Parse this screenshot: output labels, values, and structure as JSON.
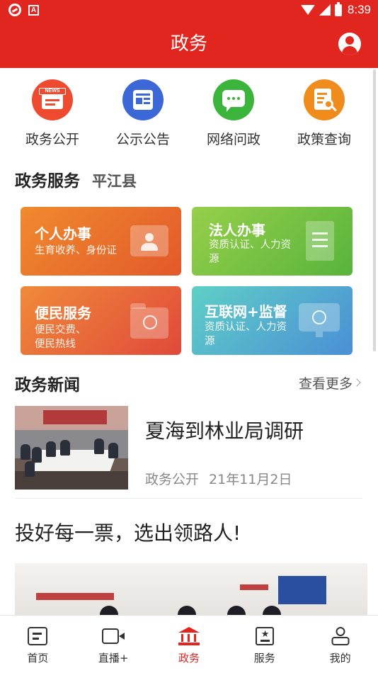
{
  "status_bar": {
    "time": "8:39",
    "icons": [
      "app-notification-icon",
      "app-a-icon",
      "wifi-icon",
      "signal-icon",
      "battery-charging-icon"
    ]
  },
  "header": {
    "title": "政务",
    "right_icon": "user-icon"
  },
  "quick_links": [
    {
      "label": "政务公开",
      "icon": "news-icon",
      "color": "#ee4a30"
    },
    {
      "label": "公示公告",
      "icon": "notice-icon",
      "color": "#3c67d6"
    },
    {
      "label": "网络问政",
      "icon": "chat-icon",
      "color": "#3ab43a"
    },
    {
      "label": "政策查询",
      "icon": "policy-search-icon",
      "color": "#f08c1c"
    }
  ],
  "services": {
    "title": "政务服务",
    "county": "平江县",
    "cards": [
      {
        "title": "个人办事",
        "subtitle": "生育收养、身份证",
        "icon": "person-id-icon"
      },
      {
        "title": "法人办事",
        "subtitle": "资质认证、人力资源",
        "icon": "document-icon"
      },
      {
        "title": "便民服务",
        "subtitle": "便民交费、便民热线",
        "icon": "folder-compass-icon"
      },
      {
        "title": "互联网+监督",
        "subtitle": "资质认证、人力资源",
        "icon": "monitor-eye-icon"
      }
    ]
  },
  "news": {
    "title": "政务新闻",
    "more_label": "查看更多",
    "items": [
      {
        "title": "夏海到林业局调研",
        "category": "政务公开",
        "date": "21年11月2日"
      }
    ]
  },
  "feature": {
    "headline": "投好每一票，选出领路人!"
  },
  "bottom_nav": [
    {
      "label": "首页",
      "icon": "home-icon",
      "active": false
    },
    {
      "label": "直播+",
      "icon": "video-camera-icon",
      "active": false
    },
    {
      "label": "政务",
      "icon": "government-building-icon",
      "active": true
    },
    {
      "label": "服务",
      "icon": "service-star-icon",
      "active": false
    },
    {
      "label": "我的",
      "icon": "profile-icon",
      "active": false
    }
  ],
  "colors": {
    "brand_red": "#e0261f",
    "text_primary": "#222222",
    "text_secondary": "#888888"
  }
}
